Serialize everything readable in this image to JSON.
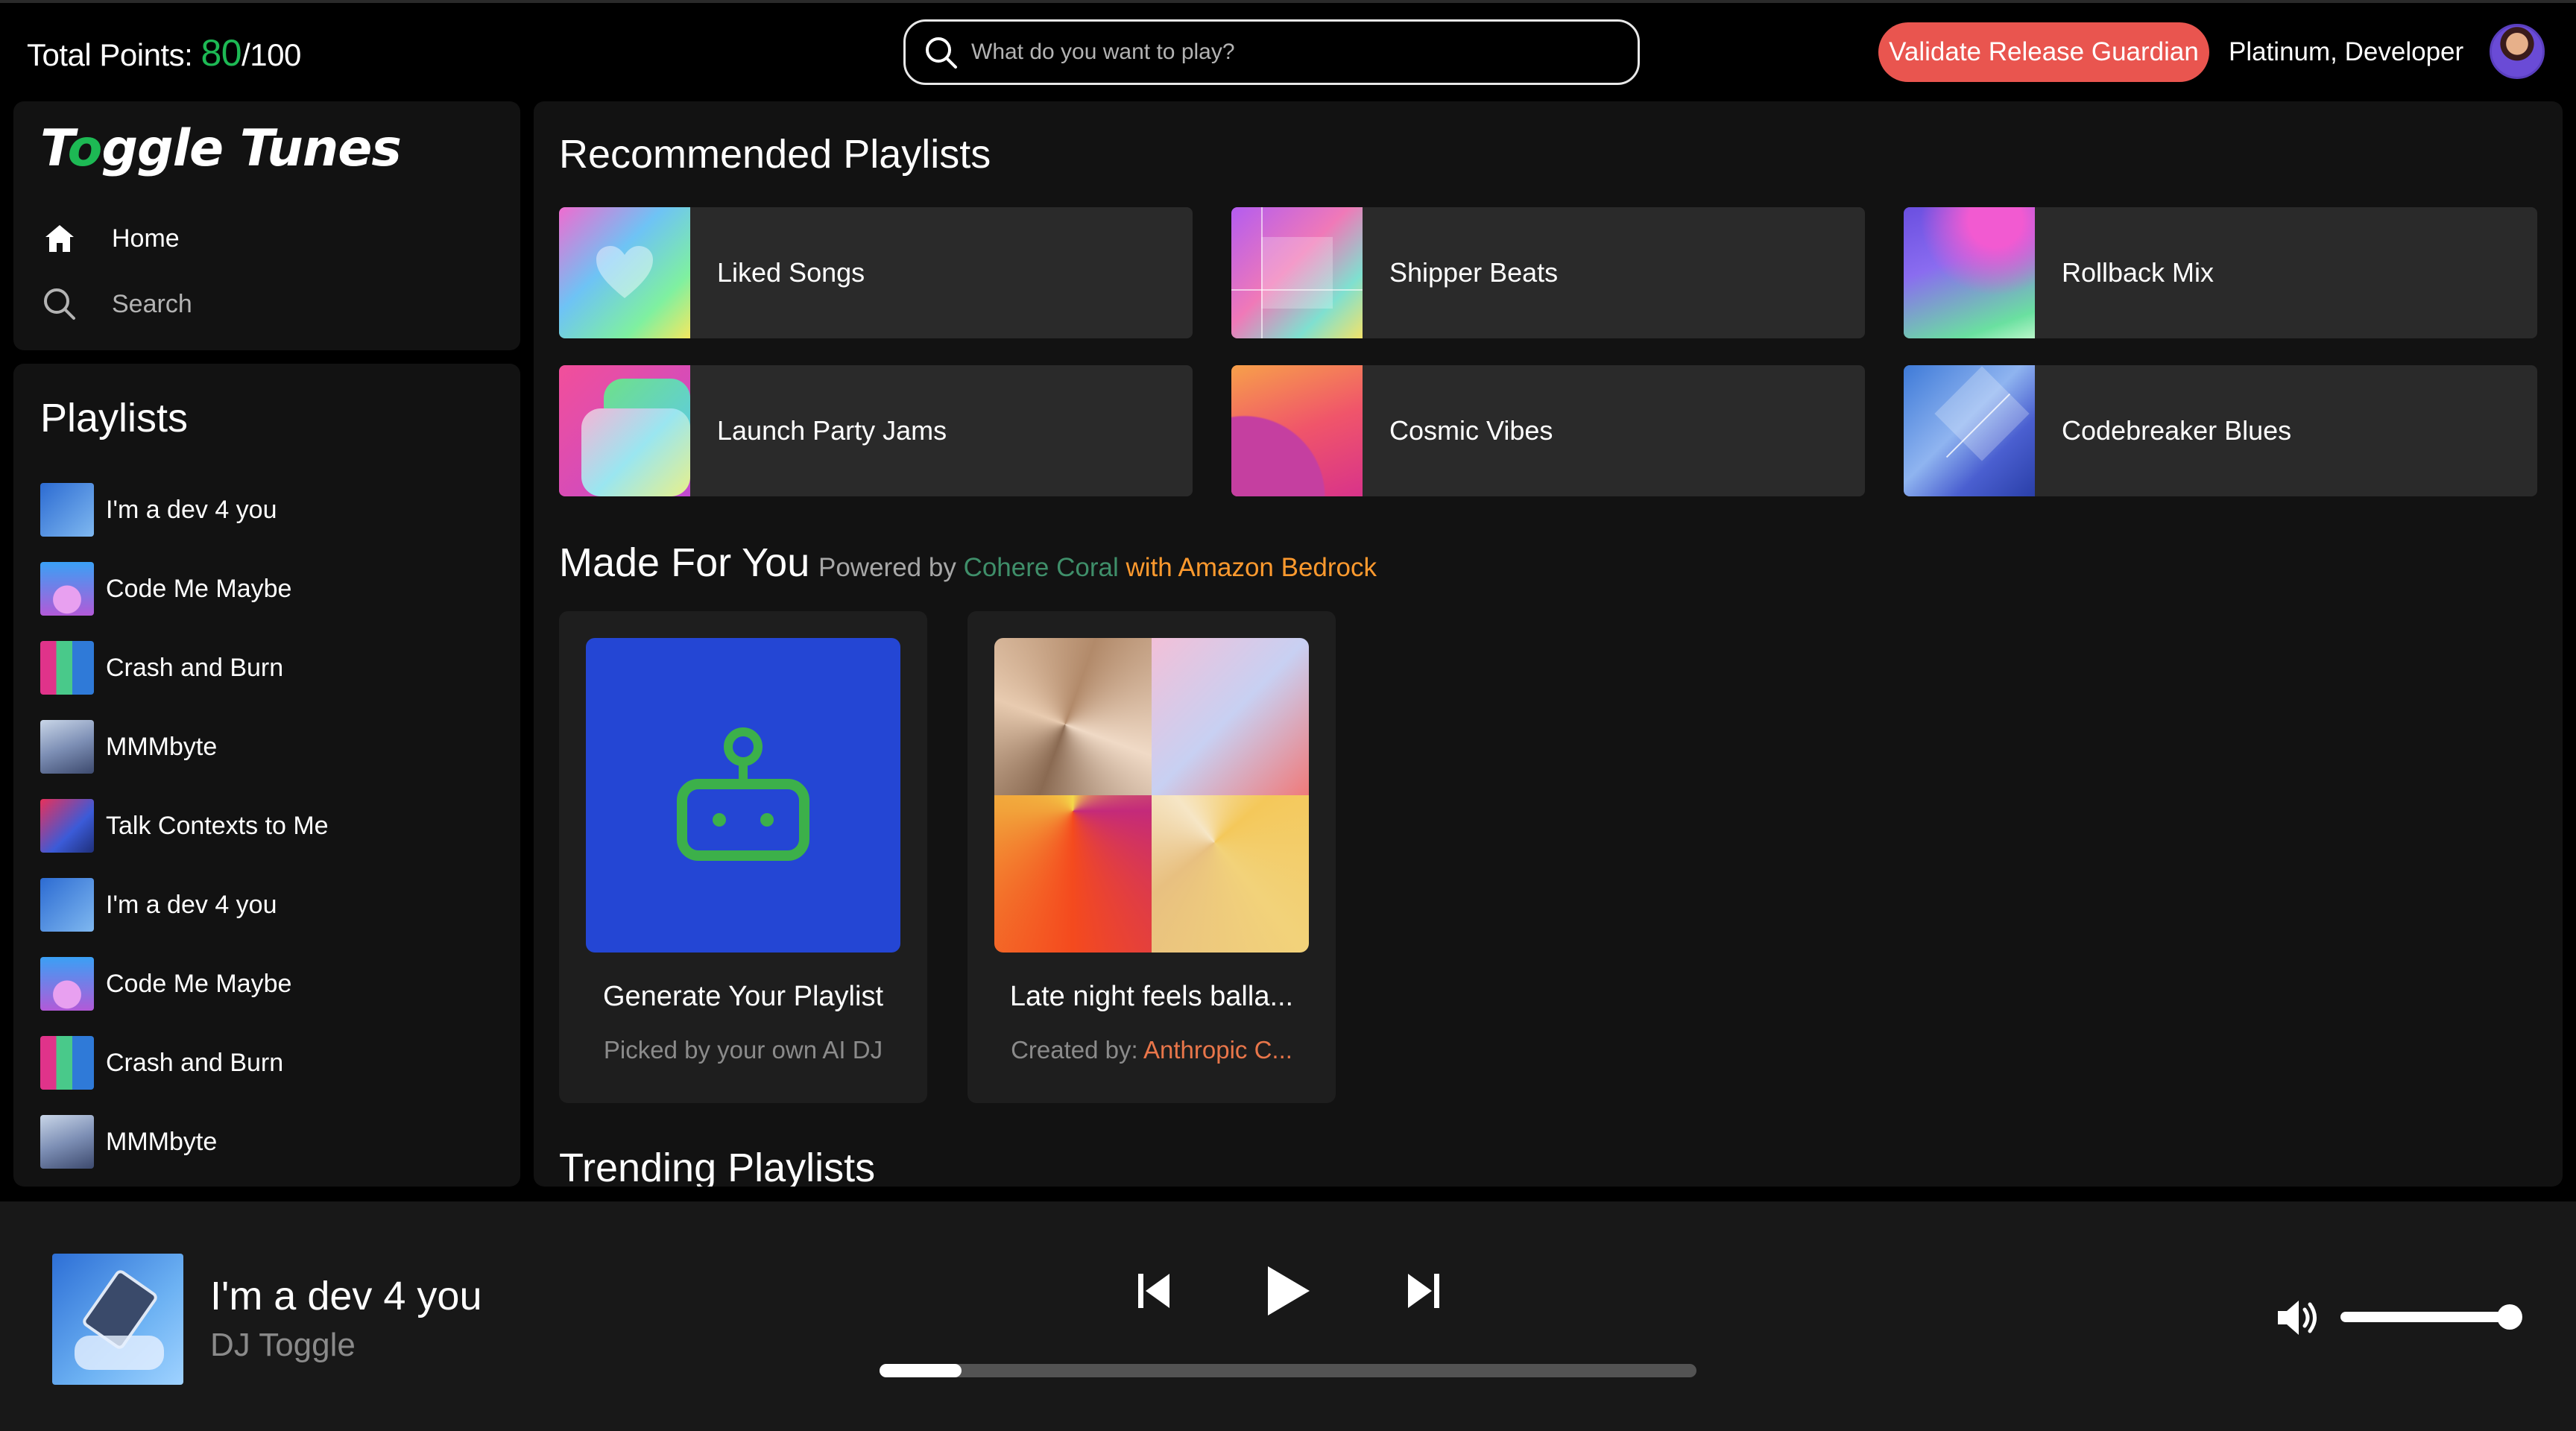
{
  "header": {
    "points_label": "Total Points:",
    "points_value": "80",
    "points_total": "/100",
    "search_placeholder": "What do you want to play?",
    "validate_button": "Validate Release Guardian",
    "user_name": "Platinum, Developer"
  },
  "sidebar": {
    "logo_pre": "T",
    "logo_o": "o",
    "logo_post": "ggle Tunes",
    "nav": [
      {
        "label": "Home",
        "icon": "home-icon"
      },
      {
        "label": "Search",
        "icon": "search-icon"
      }
    ],
    "playlists_title": "Playlists",
    "playlists": [
      {
        "label": "I'm a dev 4 you"
      },
      {
        "label": "Code Me Maybe"
      },
      {
        "label": "Crash and Burn"
      },
      {
        "label": "MMMbyte"
      },
      {
        "label": "Talk Contexts to Me"
      },
      {
        "label": "I'm a dev 4 you"
      },
      {
        "label": "Code Me Maybe"
      },
      {
        "label": "Crash and Burn"
      },
      {
        "label": "MMMbyte"
      }
    ]
  },
  "main": {
    "recommended_title": "Recommended Playlists",
    "recommended": [
      {
        "label": "Liked Songs"
      },
      {
        "label": "Shipper Beats"
      },
      {
        "label": "Rollback Mix"
      },
      {
        "label": "Launch Party Jams"
      },
      {
        "label": "Cosmic Vibes"
      },
      {
        "label": "Codebreaker Blues"
      }
    ],
    "made_for_you_title": "Made For You",
    "powered_by": "Powered by",
    "powered_coral": "Cohere Coral",
    "powered_aws": "with Amazon Bedrock",
    "made_for_you": [
      {
        "title": "Generate Your Playlist",
        "subtitle": "Picked by your own AI DJ",
        "icon": "robot-icon"
      },
      {
        "title": "Late night feels balla...",
        "subtitle_prefix": "Created by:",
        "subtitle_maker": "Anthropic C..."
      }
    ],
    "trending_title": "Trending Playlists"
  },
  "player": {
    "track_title": "I'm a dev 4 you",
    "artist": "DJ Toggle",
    "progress": 0.1,
    "volume": 0.9
  },
  "colors": {
    "accent_green": "#1db954",
    "validate_red": "#e9554f",
    "aws_orange": "#ff9a2e",
    "robot_bg": "#2446d4",
    "robot_green": "#3cb04a"
  }
}
